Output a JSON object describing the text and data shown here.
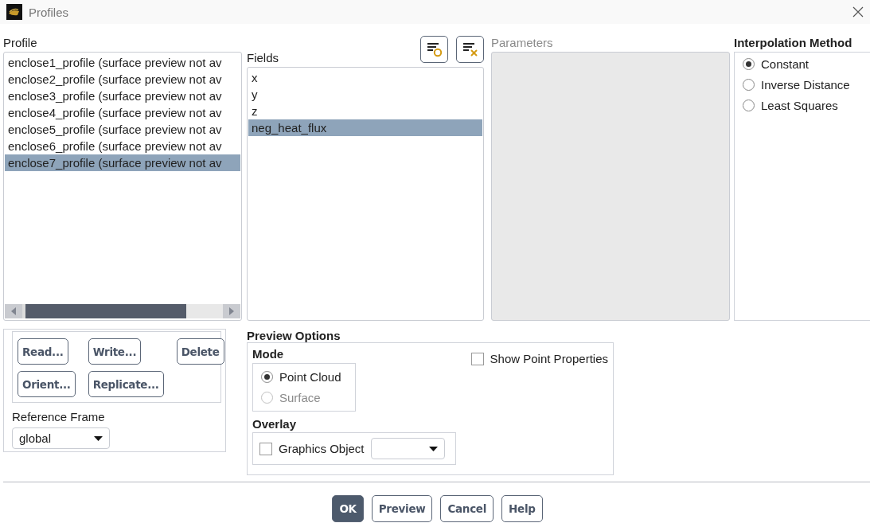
{
  "window": {
    "title": "Profiles"
  },
  "profile": {
    "label": "Profile",
    "items": [
      {
        "label": "enclose1_profile (surface preview not av",
        "selected": false
      },
      {
        "label": "enclose2_profile (surface preview not av",
        "selected": false
      },
      {
        "label": "enclose3_profile (surface preview not av",
        "selected": false
      },
      {
        "label": "enclose4_profile (surface preview not av",
        "selected": false
      },
      {
        "label": "enclose5_profile (surface preview not av",
        "selected": false
      },
      {
        "label": "enclose6_profile (surface preview not av",
        "selected": false
      },
      {
        "label": "enclose7_profile (surface preview not av",
        "selected": true
      }
    ]
  },
  "fields": {
    "label": "Fields",
    "items": [
      {
        "label": "x",
        "selected": false
      },
      {
        "label": "y",
        "selected": false
      },
      {
        "label": "z",
        "selected": false
      },
      {
        "label": "neg_heat_flux",
        "selected": true
      }
    ]
  },
  "parameters": {
    "label": "Parameters",
    "disabled": true
  },
  "interpolation": {
    "label": "Interpolation Method",
    "options": [
      {
        "label": "Constant",
        "selected": true
      },
      {
        "label": "Inverse Distance",
        "selected": false
      },
      {
        "label": "Least Squares",
        "selected": false
      }
    ]
  },
  "profile_actions": [
    {
      "label": "Read..."
    },
    {
      "label": "Write..."
    },
    {
      "label": "Delete"
    },
    {
      "label": "Orient..."
    },
    {
      "label": "Replicate..."
    }
  ],
  "reference_frame": {
    "label": "Reference Frame",
    "value": "global"
  },
  "preview_options": {
    "label": "Preview Options",
    "mode": {
      "label": "Mode",
      "options": [
        {
          "label": "Point Cloud",
          "selected": true,
          "disabled": false
        },
        {
          "label": "Surface",
          "selected": false,
          "disabled": true
        }
      ]
    },
    "show_point_properties": {
      "label": "Show Point Properties",
      "checked": false
    },
    "overlay": {
      "label": "Overlay",
      "graphics_object": {
        "label": "Graphics Object",
        "checked": false
      }
    }
  },
  "buttons": [
    {
      "label": "OK",
      "kind": "primary"
    },
    {
      "label": "Preview",
      "kind": "normal"
    },
    {
      "label": "Cancel",
      "kind": "normal"
    },
    {
      "label": "Help",
      "kind": "normal"
    }
  ]
}
